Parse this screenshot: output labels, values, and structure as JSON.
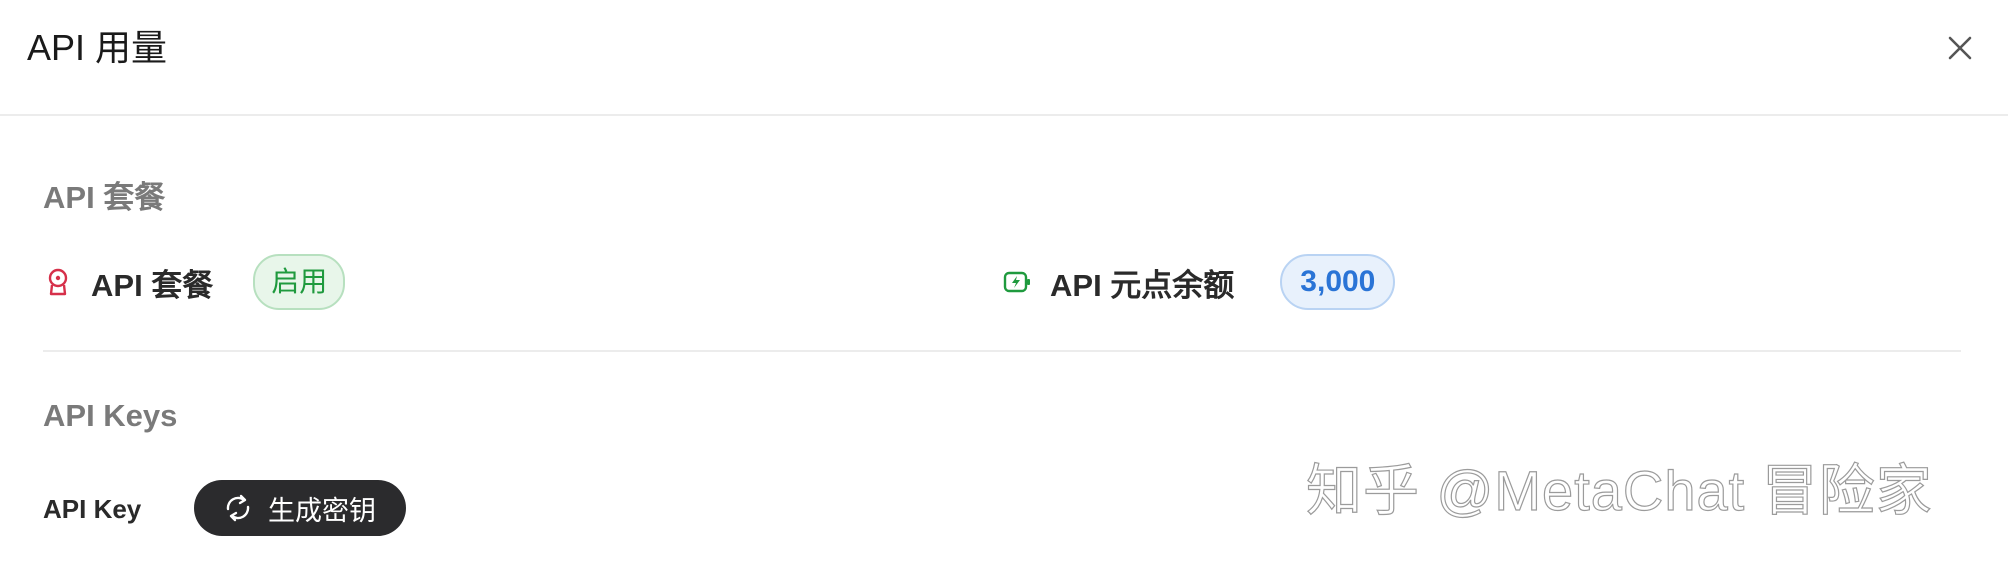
{
  "header": {
    "title": "API 用量"
  },
  "plan_section": {
    "title": "API 套餐",
    "plan": {
      "label": "API 套餐",
      "status": "启用",
      "icon": "badge-icon"
    },
    "credits": {
      "label": "API 元点余额",
      "value": "3,000",
      "icon": "battery-charging-icon"
    }
  },
  "keys_section": {
    "title": "API Keys",
    "api_key_label": "API Key",
    "generate_button": "生成密钥"
  },
  "watermark": "知乎 @MetaChat 冒险家",
  "colors": {
    "plan_icon": "#d6304a",
    "credit_icon": "#1f9a3e",
    "status_green": "#1f9a3e",
    "value_blue": "#2a74d6",
    "button_dark": "#2b2b2d"
  }
}
